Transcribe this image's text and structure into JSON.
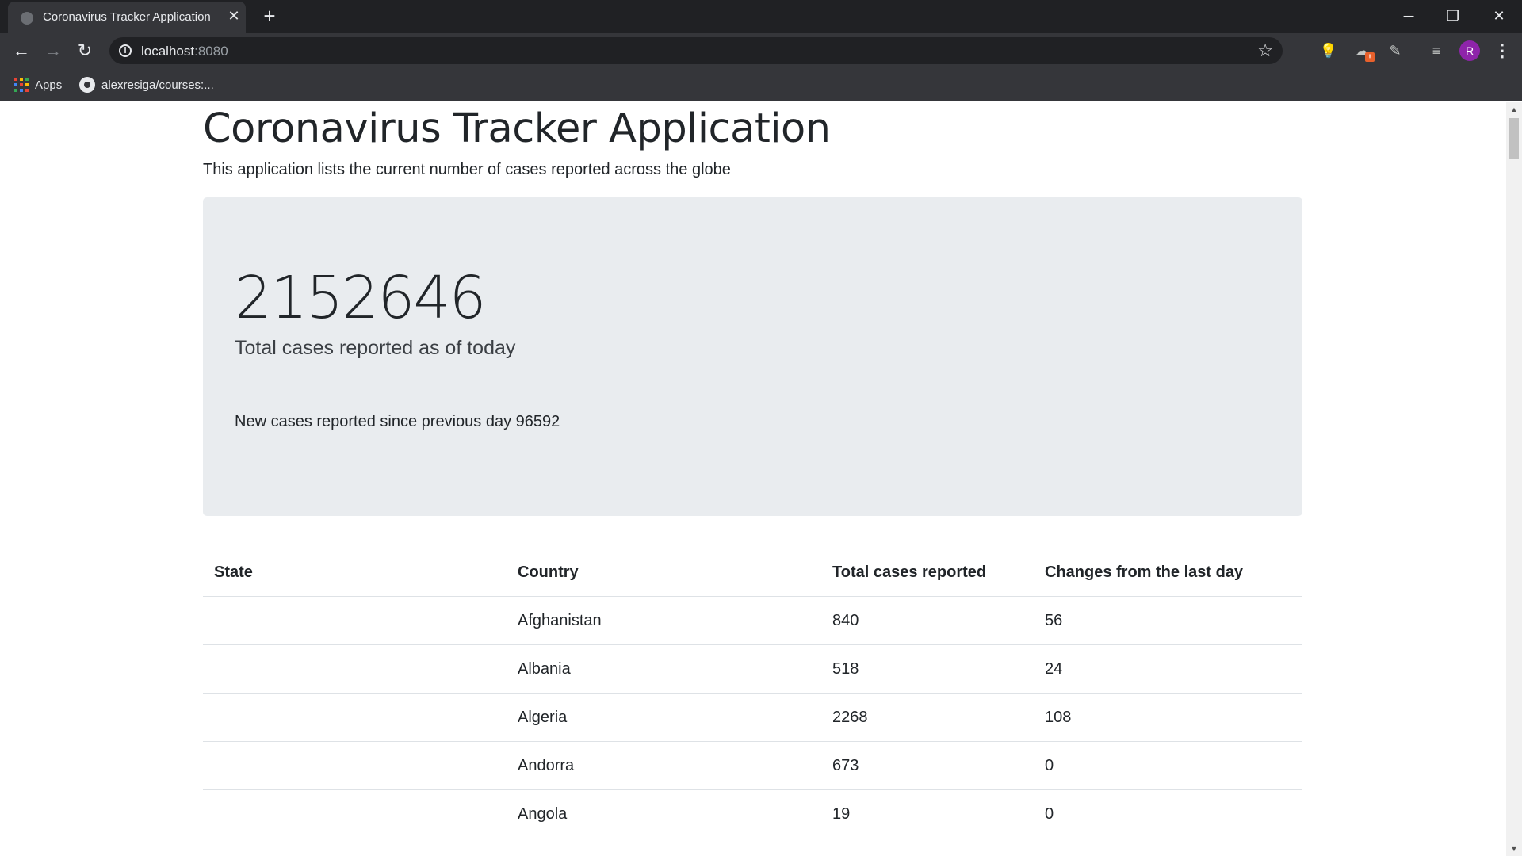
{
  "browser": {
    "tab_title": "Coronavirus Tracker Application",
    "url_host": "localhost",
    "url_port": ":8080",
    "avatar_letter": "R",
    "extension_badge": "!",
    "bookmarks": [
      {
        "label": "Apps",
        "icon": "apps-grid-icon"
      },
      {
        "label": "alexresiga/courses:...",
        "icon": "github-icon"
      }
    ]
  },
  "page": {
    "title": "Coronavirus Tracker Application",
    "lead": "This application lists the current number of cases reported across the globe"
  },
  "summary": {
    "total_cases": "2152646",
    "total_caption": "Total cases reported as of today",
    "new_cases_text": "New cases reported since previous day 96592"
  },
  "table": {
    "headers": [
      "State",
      "Country",
      "Total cases reported",
      "Changes from the last day"
    ],
    "rows": [
      {
        "state": "",
        "country": "Afghanistan",
        "total": "840",
        "change": "56"
      },
      {
        "state": "",
        "country": "Albania",
        "total": "518",
        "change": "24"
      },
      {
        "state": "",
        "country": "Algeria",
        "total": "2268",
        "change": "108"
      },
      {
        "state": "",
        "country": "Andorra",
        "total": "673",
        "change": "0"
      },
      {
        "state": "",
        "country": "Angola",
        "total": "19",
        "change": "0"
      }
    ]
  },
  "colors": {
    "chrome_dark": "#202124",
    "chrome_toolbar": "#35363a",
    "jumbotron_bg": "#e9ecef",
    "text": "#212529",
    "avatar": "#8e24aa"
  }
}
